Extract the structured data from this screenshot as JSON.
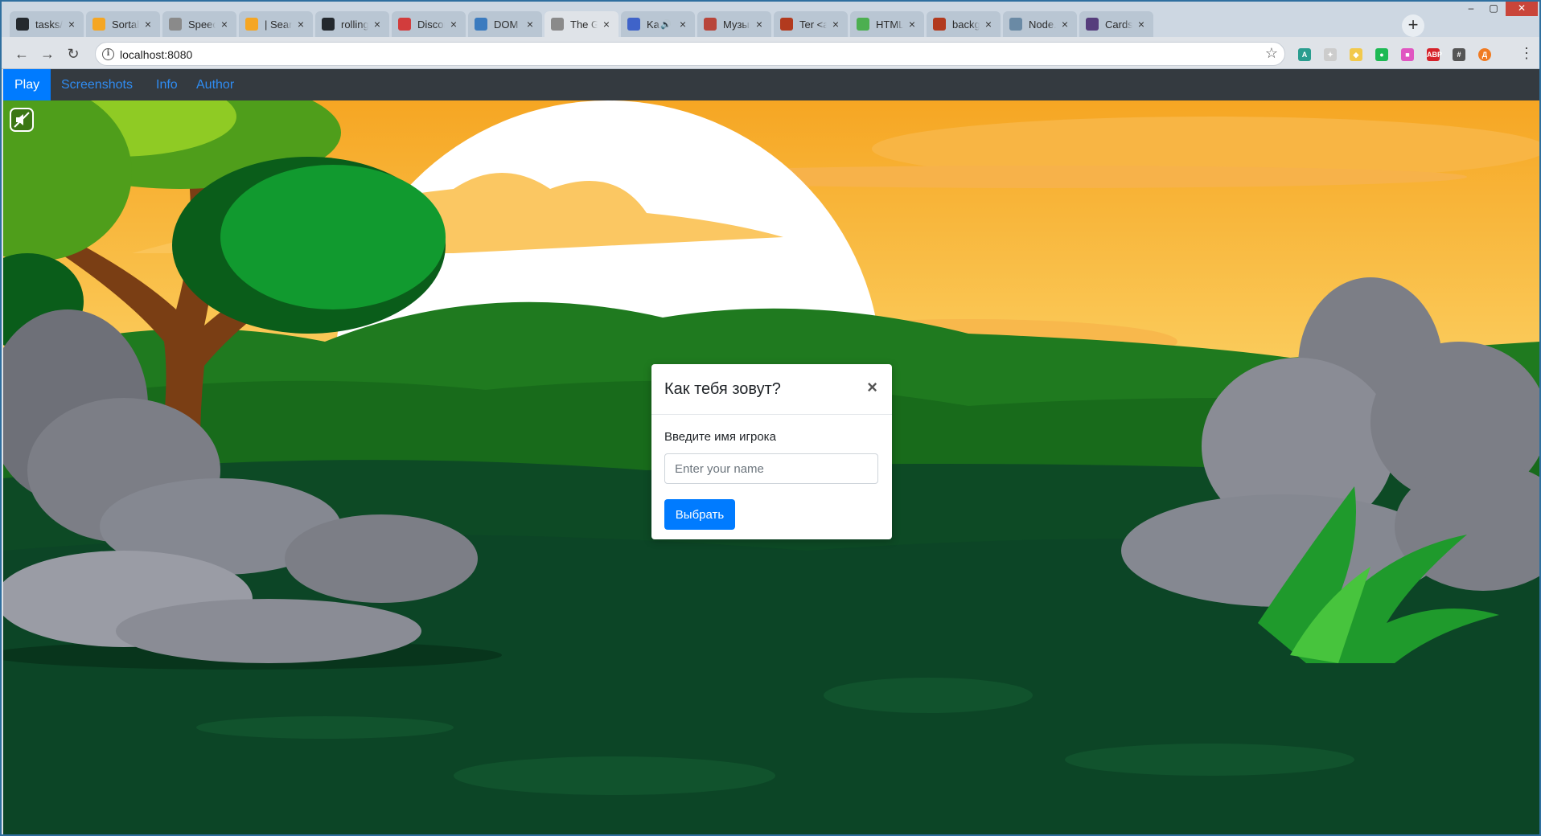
{
  "browser": {
    "tabs": [
      {
        "label": "tasks/gar",
        "favicon": "github-icon",
        "color": "#24292e"
      },
      {
        "label": "Sortable",
        "favicon": "uprock-icon",
        "color": "#f5a623"
      },
      {
        "label": "Speech sy",
        "favicon": "document-icon",
        "color": "#8a8a8a"
      },
      {
        "label": "| Search F",
        "favicon": "uprock-icon",
        "color": "#f5a623"
      },
      {
        "label": "rolling-sc",
        "favicon": "github-icon",
        "color": "#24292e"
      },
      {
        "label": "Discord",
        "favicon": "discord-icon",
        "color": "#d23c3c"
      },
      {
        "label": "DOM Rep",
        "favicon": "edge-icon",
        "color": "#3b7bbf"
      },
      {
        "label": "The Gam",
        "favicon": "document-icon",
        "color": "#8a8a8a"
      },
      {
        "label": "Kame",
        "favicon": "video-icon",
        "color": "#3f63c9"
      },
      {
        "label": "Музыка",
        "favicon": "music-icon",
        "color": "#b8453a"
      },
      {
        "label": "Ter <aud",
        "favicon": "blocks-icon",
        "color": "#b23a1e"
      },
      {
        "label": "HTML Au",
        "favicon": "w3-icon",
        "color": "#4caf50"
      },
      {
        "label": "backgrou",
        "favicon": "blocks-icon",
        "color": "#b23a1e"
      },
      {
        "label": "Node.js, l",
        "favicon": "habr-icon",
        "color": "#6a8aa5"
      },
      {
        "label": "Cards · B",
        "favicon": "bootstrap-icon",
        "color": "#563d7c"
      }
    ],
    "url": "localhost:8080",
    "extensions": [
      "A",
      "✦",
      "◆",
      "●",
      "■",
      "ABP",
      "#",
      "Д"
    ]
  },
  "nav": {
    "play": "Play",
    "screenshots": "Screenshots",
    "info": "Info",
    "author": "Author"
  },
  "modal": {
    "title": "Как тебя зовут?",
    "close": "×",
    "label": "Введите имя игрока",
    "placeholder": "Enter your name",
    "button": "Выбрать"
  },
  "colors": {
    "accent": "#007bff",
    "navbar": "#343a40"
  }
}
